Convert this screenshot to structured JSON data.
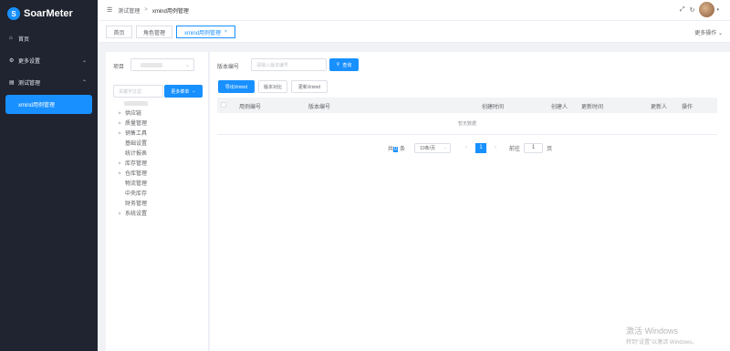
{
  "sidebar": {
    "logo_text": "SoarMeter",
    "items": [
      {
        "icon": "home-icon",
        "glyph": "⌂",
        "label": "首页"
      },
      {
        "icon": "more-settings-icon",
        "glyph": "⚙",
        "label": "更多设置"
      },
      {
        "icon": "test-icon",
        "glyph": "▤",
        "label": "测试管理"
      }
    ],
    "submenu_active": "xmind用例管理"
  },
  "header": {
    "breadcrumb": [
      "测试管理",
      "xmind用例管理"
    ]
  },
  "tags": {
    "items": [
      "首页",
      "角色管理",
      "xmind用例管理"
    ],
    "active_close": "×",
    "more_label": "更多操作"
  },
  "left_panel": {
    "project_label": "项目",
    "search_placeholder": "关键字过滤",
    "more_menu_label": "更多菜单",
    "tree": [
      {
        "label": "供应链",
        "has_children": true
      },
      {
        "label": "质量管理",
        "has_children": true
      },
      {
        "label": "销售工具",
        "has_children": true
      },
      {
        "label": "基础设置",
        "has_children": false
      },
      {
        "label": "统计报表",
        "has_children": false
      },
      {
        "label": "库存管理",
        "has_children": true
      },
      {
        "label": "仓库管理",
        "has_children": true
      },
      {
        "label": "物流管理",
        "has_children": false
      },
      {
        "label": "中央库存",
        "has_children": false
      },
      {
        "label": "财务管理",
        "has_children": false
      },
      {
        "label": "系统设置",
        "has_children": true
      }
    ]
  },
  "right_panel": {
    "version_label": "版本编号",
    "version_placeholder": "请输入版本编号",
    "query_label": "查询",
    "buttons": {
      "export": "导出Xmind",
      "compare": "版本对比",
      "update": "更新Xmind"
    },
    "table": {
      "columns": [
        "用例编号",
        "版本编号",
        "创建时间",
        "创建人",
        "更新时间",
        "更新人",
        "操作"
      ],
      "empty_text": "暂无数据"
    },
    "pagination": {
      "total_prefix": "共",
      "total_value": "0",
      "total_suffix": "条",
      "page_size": "10条/页",
      "current_page": "1",
      "goto_label": "前往",
      "goto_value": "1",
      "page_suffix": "页"
    }
  },
  "watermark": {
    "line1": "激活 Windows",
    "line2": "转到\"设置\"以激活 Windows。"
  },
  "colors": {
    "accent": "#1890ff",
    "sidebar_bg": "#1f2430"
  }
}
